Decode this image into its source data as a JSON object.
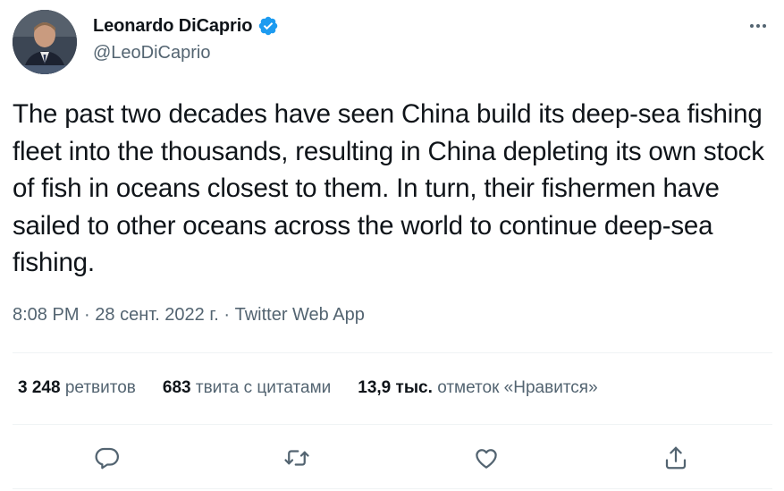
{
  "tweet": {
    "author": {
      "display_name": "Leonardo DiCaprio",
      "handle": "@LeoDiCaprio",
      "verified": true,
      "avatar": "avatar-photo"
    },
    "text": "The past two decades have seen China build its deep-sea fishing fleet into the thousands, resulting in China depleting its own stock of fish in oceans closest to them. In turn, their fishermen have sailed to other oceans across the world to continue deep-sea fishing.",
    "time": "8:08 PM",
    "separator": "·",
    "date": "28 сент. 2022 г.",
    "source": "Twitter Web App"
  },
  "stats": {
    "retweets": {
      "count": "3 248",
      "label": "ретвитов"
    },
    "quotes": {
      "count": "683",
      "label": "твита с цитатами"
    },
    "likes": {
      "count": "13,9 тыс.",
      "label": "отметок «Нравится»"
    }
  },
  "icons": {
    "more": "more-horizontal-icon",
    "reply": "reply-icon",
    "retweet": "retweet-icon",
    "like": "heart-icon",
    "share": "share-icon",
    "verified": "verified-badge-icon"
  },
  "colors": {
    "text_primary": "#0f1419",
    "text_secondary": "#536471",
    "verified": "#1d9bf0",
    "divider": "#eff3f4"
  }
}
